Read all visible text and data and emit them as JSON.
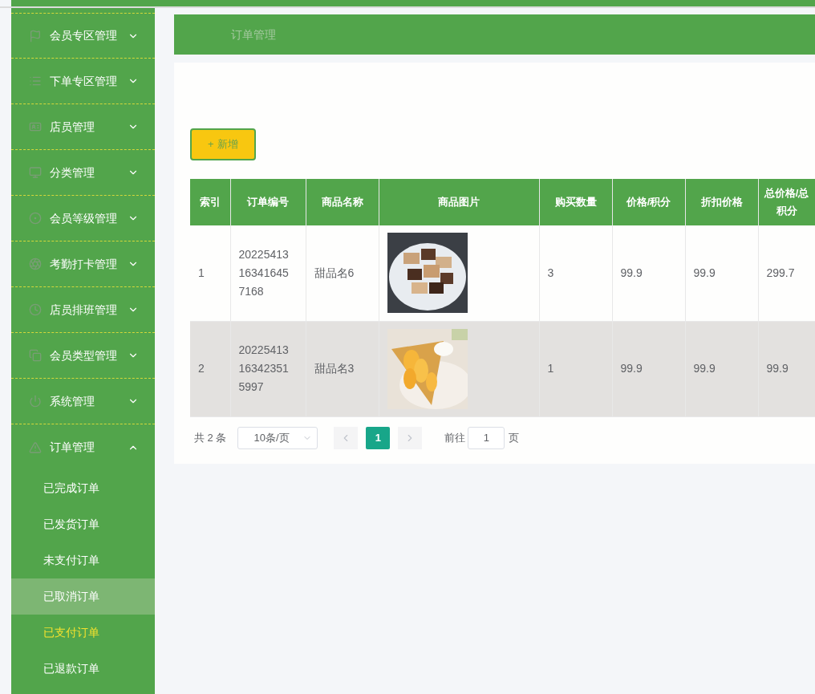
{
  "sidebar": {
    "menus": [
      {
        "label": "会员专区管理",
        "expanded": false
      },
      {
        "label": "下单专区管理",
        "expanded": false
      },
      {
        "label": "店员管理",
        "expanded": false
      },
      {
        "label": "分类管理",
        "expanded": false
      },
      {
        "label": "会员等级管理",
        "expanded": false
      },
      {
        "label": "考勤打卡管理",
        "expanded": false
      },
      {
        "label": "店员排班管理",
        "expanded": false
      },
      {
        "label": "会员类型管理",
        "expanded": false
      },
      {
        "label": "系统管理",
        "expanded": false
      },
      {
        "label": "订单管理",
        "expanded": true,
        "children": [
          {
            "label": "已完成订单",
            "selected": false,
            "hovered": false
          },
          {
            "label": "已发货订单",
            "selected": false,
            "hovered": false
          },
          {
            "label": "未支付订单",
            "selected": false,
            "hovered": false
          },
          {
            "label": "已取消订单",
            "selected": false,
            "hovered": true
          },
          {
            "label": "已支付订单",
            "selected": true,
            "hovered": false
          },
          {
            "label": "已退款订单",
            "selected": false,
            "hovered": false
          }
        ]
      }
    ]
  },
  "breadcrumb": "订单管理",
  "add_button": {
    "icon": "+",
    "label": "新增"
  },
  "table": {
    "columns": [
      {
        "label": "索引",
        "kind": "text"
      },
      {
        "label": "订单编号",
        "kind": "text"
      },
      {
        "label": "商品名称",
        "kind": "text"
      },
      {
        "label": "商品图片",
        "kind": "picture"
      },
      {
        "label": "购买数量",
        "kind": "text"
      },
      {
        "label": "价格/积分",
        "kind": "text"
      },
      {
        "label": "折扣价格",
        "kind": "text"
      },
      {
        "label": "总价格/总积分",
        "kind": "text"
      }
    ],
    "rows": [
      {
        "highlighted": false,
        "cells": [
          "1",
          "20225413163416457168",
          "甜品名6",
          {
            "kind": "picture"
          },
          "3",
          "99.9",
          "99.9",
          "299.7"
        ]
      },
      {
        "highlighted": true,
        "cells": [
          "2",
          "20225413163423515997",
          "甜品名3",
          {
            "kind": "picture"
          },
          "1",
          "99.9",
          "99.9",
          "99.9"
        ]
      }
    ]
  },
  "pagination": {
    "total": "共 2 条",
    "page_size": "10条/页",
    "pages": [
      {
        "label": "1",
        "selected": true
      }
    ],
    "goto_label": "前往",
    "goto_value": "1",
    "goto_suffix": "页"
  }
}
